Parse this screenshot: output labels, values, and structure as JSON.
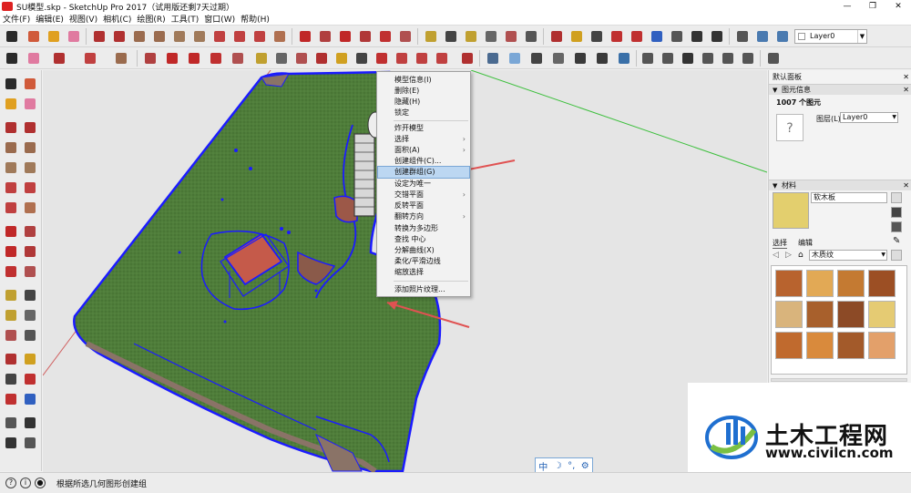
{
  "window": {
    "title": "SU模型.skp - SketchUp Pro 2017（试用版还剩7天过期）",
    "minimize": "—",
    "maximize": "❐",
    "close": "✕"
  },
  "menubar": {
    "items": [
      "文件(F)",
      "编辑(E)",
      "视图(V)",
      "相机(C)",
      "绘图(R)",
      "工具(T)",
      "窗口(W)",
      "帮助(H)"
    ]
  },
  "toolbar": {
    "layer_value": "Layer0"
  },
  "context_menu": {
    "items": [
      {
        "label": "模型信息(I)"
      },
      {
        "label": "删除(E)"
      },
      {
        "label": "隐藏(H)"
      },
      {
        "label": "锁定"
      },
      {
        "label": "炸开模型"
      },
      {
        "label": "选择",
        "submenu": true
      },
      {
        "label": "面积(A)",
        "submenu": true
      },
      {
        "label": "创建组件(C)..."
      },
      {
        "label": "创建群组(G)",
        "highlighted": true
      },
      {
        "label": "设定为唯一"
      },
      {
        "label": "交错平面",
        "submenu": true
      },
      {
        "label": "反转平面"
      },
      {
        "label": "翻转方向",
        "submenu": true
      },
      {
        "label": "转换为多边形"
      },
      {
        "label": "查找 中心"
      },
      {
        "label": "分解曲线(X)"
      },
      {
        "label": "柔化/平滑边线"
      },
      {
        "label": "缩放选择"
      },
      {
        "label": "添加照片纹理..."
      }
    ]
  },
  "right_panel": {
    "title": "默认面板",
    "entity_info": {
      "header": "图元信息",
      "count": "1007 个图元",
      "layer_label": "图层(L):",
      "layer_value": "Layer0",
      "preview_symbol": "?"
    },
    "materials": {
      "header": "材料",
      "current_name": "软木板",
      "tab_select": "选择",
      "tab_edit": "编辑",
      "library": "木质纹"
    }
  },
  "status_bar": {
    "text": "根据所选几何图形创建组"
  },
  "ime": {
    "mode": "中",
    "moon": "☽",
    "punct": "°,",
    "settings": "⚙"
  },
  "watermark": {
    "name": "土木工程网",
    "url": "www.civilcn.com"
  },
  "colors": {
    "ground": "#4f7d3a",
    "selection": "#1b1bff",
    "building": "#c55a4a",
    "path": "#8a7367",
    "highlight": "#bcd7f2",
    "arrow": "#e05252"
  }
}
